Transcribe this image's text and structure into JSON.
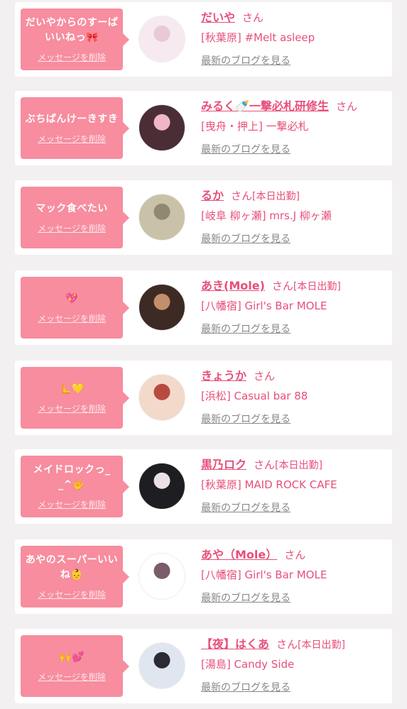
{
  "follow_list": [
    {
      "message": "だいやからのすーぱいいねっ🎀",
      "delete_label": "メッセージを削除",
      "name": "だいや",
      "honorific": "さん",
      "status": "",
      "shop": "[秋葉原] #Melt asleep",
      "blog_link": "最新のブログを見る",
      "avatar_colors": [
        "#f6e9ef",
        "#e7c9d8"
      ]
    },
    {
      "message": "ぶちぱんけーきすき",
      "delete_label": "メッセージを削除",
      "name": "みるく🍼一撃必札研修生",
      "honorific": "さん",
      "status": "",
      "shop": "[曳舟・押上] 一撃必札",
      "blog_link": "最新のブログを見る",
      "avatar_colors": [
        "#4a2d35",
        "#f0b6c8"
      ]
    },
    {
      "message": "マック食べたい",
      "delete_label": "メッセージを削除",
      "name": "るか",
      "honorific": "さん",
      "status": "[本日出勤]",
      "shop": "[岐阜 柳ヶ瀬] mrs.J 柳ヶ瀬",
      "blog_link": "最新のブログを見る",
      "avatar_colors": [
        "#c9c2a8",
        "#8f8a6f"
      ]
    },
    {
      "message": "💖",
      "delete_label": "メッセージを削除",
      "name": "あき(Mole)",
      "honorific": "さん",
      "status": "[本日出勤]",
      "shop": "[八幡宿] Girl's Bar MOLE",
      "blog_link": "最新のブログを見る",
      "avatar_colors": [
        "#3d2a24",
        "#c28e6b"
      ]
    },
    {
      "message": "🫷💛",
      "delete_label": "メッセージを削除",
      "name": "きょうか",
      "honorific": "さん",
      "status": "",
      "shop": "[浜松] Casual bar 88",
      "blog_link": "最新のブログを見る",
      "avatar_colors": [
        "#f2d9c9",
        "#b94a3f"
      ]
    },
    {
      "message": "メイドロックっ_ _^🤟",
      "delete_label": "メッセージを削除",
      "name": "黒乃ロク",
      "honorific": "さん",
      "status": "[本日出勤]",
      "shop": "[秋葉原] MAID ROCK CAFE",
      "blog_link": "最新のブログを見る",
      "avatar_colors": [
        "#1e1e22",
        "#e9e1e4"
      ]
    },
    {
      "message": "あやのスーパーいいね👶",
      "delete_label": "メッセージを削除",
      "name": "あや（Mole）",
      "honorific": "さん",
      "status": "",
      "shop": "[八幡宿] Girl's Bar MOLE",
      "blog_link": "最新のブログを見る",
      "avatar_colors": [
        "#ffffff",
        "#7a5c6a"
      ]
    },
    {
      "message": "🙌💕",
      "delete_label": "メッセージを削除",
      "name": "【夜】はくあ",
      "honorific": "さん",
      "status": "[本日出勤]",
      "shop": "[湯島] Candy Side",
      "blog_link": "最新のブログを見る",
      "avatar_colors": [
        "#dfe6f0",
        "#2b2b33"
      ]
    }
  ]
}
